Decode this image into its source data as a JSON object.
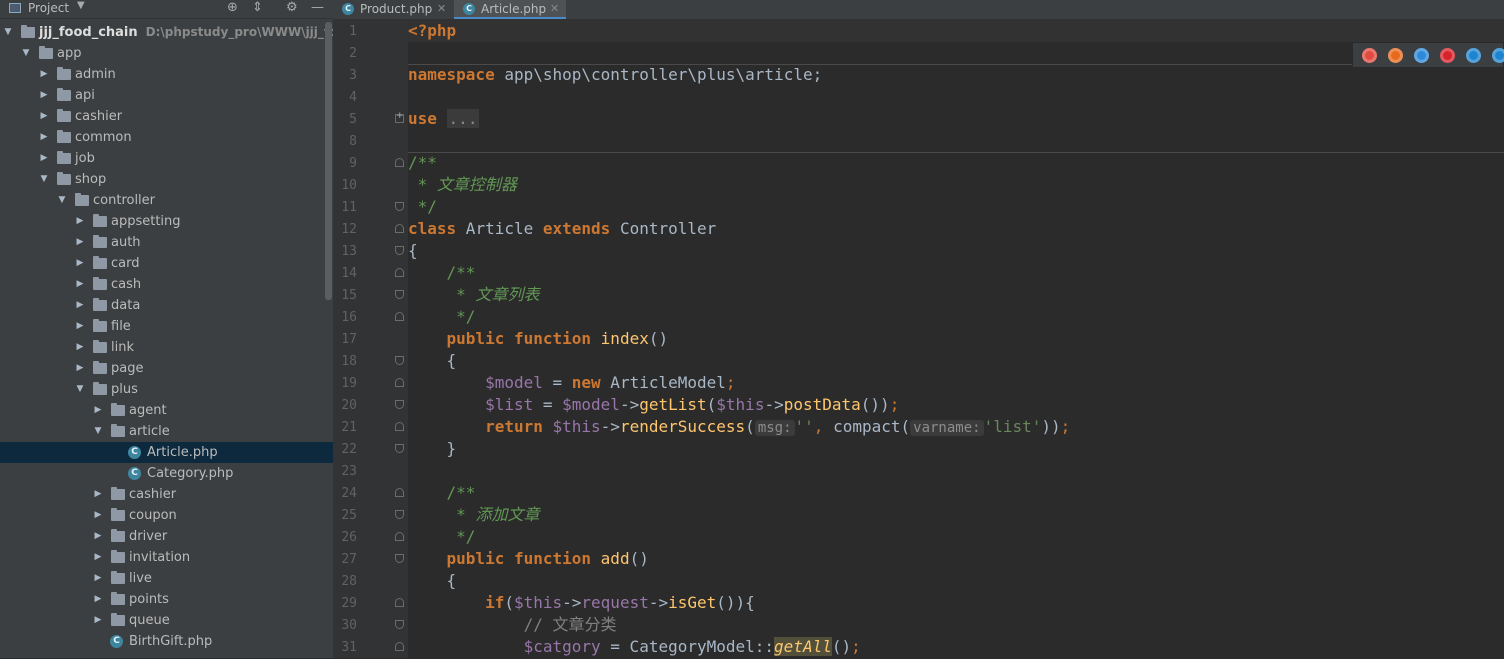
{
  "project_panel": {
    "title": "Project",
    "tree": [
      {
        "label": "jjj_food_chain",
        "hint": "D:\\phpstudy_pro\\WWW\\jjj_food_ch",
        "type": "root",
        "depth": 0,
        "open": true
      },
      {
        "label": "app",
        "type": "folder",
        "depth": 1,
        "open": true
      },
      {
        "label": "admin",
        "type": "folder",
        "depth": 2,
        "open": false
      },
      {
        "label": "api",
        "type": "folder",
        "depth": 2,
        "open": false
      },
      {
        "label": "cashier",
        "type": "folder",
        "depth": 2,
        "open": false
      },
      {
        "label": "common",
        "type": "folder",
        "depth": 2,
        "open": false
      },
      {
        "label": "job",
        "type": "folder",
        "depth": 2,
        "open": false
      },
      {
        "label": "shop",
        "type": "folder",
        "depth": 2,
        "open": true
      },
      {
        "label": "controller",
        "type": "folder",
        "depth": 3,
        "open": true
      },
      {
        "label": "appsetting",
        "type": "folder",
        "depth": 4,
        "open": false
      },
      {
        "label": "auth",
        "type": "folder",
        "depth": 4,
        "open": false
      },
      {
        "label": "card",
        "type": "folder",
        "depth": 4,
        "open": false
      },
      {
        "label": "cash",
        "type": "folder",
        "depth": 4,
        "open": false
      },
      {
        "label": "data",
        "type": "folder",
        "depth": 4,
        "open": false
      },
      {
        "label": "file",
        "type": "folder",
        "depth": 4,
        "open": false
      },
      {
        "label": "link",
        "type": "folder",
        "depth": 4,
        "open": false
      },
      {
        "label": "page",
        "type": "folder",
        "depth": 4,
        "open": false
      },
      {
        "label": "plus",
        "type": "folder",
        "depth": 4,
        "open": true
      },
      {
        "label": "agent",
        "type": "folder",
        "depth": 5,
        "open": false
      },
      {
        "label": "article",
        "type": "folder",
        "depth": 5,
        "open": true
      },
      {
        "label": "Article.php",
        "type": "file",
        "depth": 6,
        "selected": true
      },
      {
        "label": "Category.php",
        "type": "file",
        "depth": 6
      },
      {
        "label": "cashier",
        "type": "folder",
        "depth": 5,
        "open": false
      },
      {
        "label": "coupon",
        "type": "folder",
        "depth": 5,
        "open": false
      },
      {
        "label": "driver",
        "type": "folder",
        "depth": 5,
        "open": false
      },
      {
        "label": "invitation",
        "type": "folder",
        "depth": 5,
        "open": false
      },
      {
        "label": "live",
        "type": "folder",
        "depth": 5,
        "open": false
      },
      {
        "label": "points",
        "type": "folder",
        "depth": 5,
        "open": false
      },
      {
        "label": "queue",
        "type": "folder",
        "depth": 5,
        "open": false
      },
      {
        "label": "BirthGift.php",
        "type": "file",
        "depth": 5
      }
    ]
  },
  "tabs": [
    {
      "label": "Product.php",
      "active": false
    },
    {
      "label": "Article.php",
      "active": true
    }
  ],
  "editor": {
    "lines": [
      [
        {
          "c": "tag",
          "t": "<?php"
        }
      ],
      [],
      [
        {
          "c": "kw",
          "t": "namespace"
        },
        {
          "c": "",
          "t": " app\\shop\\controller\\plus\\article;"
        }
      ],
      [],
      [
        {
          "c": "kw",
          "t": "use"
        },
        {
          "c": "",
          "t": " "
        },
        {
          "c": "folded",
          "t": "..."
        }
      ],
      [],
      [],
      [],
      [
        {
          "c": "doc",
          "t": "/**"
        }
      ],
      [
        {
          "c": "doc",
          "t": " * "
        },
        {
          "c": "docz",
          "t": "文章控制器"
        }
      ],
      [
        {
          "c": "doc",
          "t": " */"
        }
      ],
      [
        {
          "c": "kw",
          "t": "class"
        },
        {
          "c": "",
          "t": " Article "
        },
        {
          "c": "kw",
          "t": "extends"
        },
        {
          "c": "",
          "t": " Controller"
        }
      ],
      [
        {
          "c": "",
          "t": "{"
        }
      ],
      [
        {
          "c": "",
          "t": "    "
        },
        {
          "c": "doc",
          "t": "/**"
        }
      ],
      [
        {
          "c": "doc",
          "t": "     * "
        },
        {
          "c": "docz",
          "t": "文章列表"
        }
      ],
      [
        {
          "c": "doc",
          "t": "     */"
        }
      ],
      [
        {
          "c": "",
          "t": "    "
        },
        {
          "c": "kw",
          "t": "public function"
        },
        {
          "c": "",
          "t": " "
        },
        {
          "c": "fn",
          "t": "index"
        },
        {
          "c": "",
          "t": "()"
        }
      ],
      [
        {
          "c": "",
          "t": "    {"
        }
      ],
      [
        {
          "c": "",
          "t": "        "
        },
        {
          "c": "var",
          "t": "$model"
        },
        {
          "c": "",
          "t": " = "
        },
        {
          "c": "kw",
          "t": "new"
        },
        {
          "c": "",
          "t": " ArticleModel"
        },
        {
          "c": "kwn",
          "t": ";"
        }
      ],
      [
        {
          "c": "",
          "t": "        "
        },
        {
          "c": "var",
          "t": "$list"
        },
        {
          "c": "",
          "t": " = "
        },
        {
          "c": "var",
          "t": "$model"
        },
        {
          "c": "",
          "t": "->"
        },
        {
          "c": "fn",
          "t": "getList"
        },
        {
          "c": "",
          "t": "("
        },
        {
          "c": "var",
          "t": "$this"
        },
        {
          "c": "",
          "t": "->"
        },
        {
          "c": "fn",
          "t": "postData"
        },
        {
          "c": "",
          "t": "())"
        },
        {
          "c": "kwn",
          "t": ";"
        }
      ],
      [
        {
          "c": "",
          "t": "        "
        },
        {
          "c": "kw",
          "t": "return"
        },
        {
          "c": "",
          "t": " "
        },
        {
          "c": "var",
          "t": "$this"
        },
        {
          "c": "",
          "t": "->"
        },
        {
          "c": "fn",
          "t": "renderSuccess"
        },
        {
          "c": "",
          "t": "("
        },
        {
          "c": "hint",
          "t": "msg:"
        },
        {
          "c": "str",
          "t": "''"
        },
        {
          "c": "kwn",
          "t": ","
        },
        {
          "c": "",
          "t": " compact("
        },
        {
          "c": "hint",
          "t": "varname:"
        },
        {
          "c": "str",
          "t": "'list'"
        },
        {
          "c": "",
          "t": "))"
        },
        {
          "c": "kwn",
          "t": ";"
        }
      ],
      [
        {
          "c": "",
          "t": "    }"
        }
      ],
      [],
      [
        {
          "c": "",
          "t": "    "
        },
        {
          "c": "doc",
          "t": "/**"
        }
      ],
      [
        {
          "c": "doc",
          "t": "     * "
        },
        {
          "c": "docz",
          "t": "添加文章"
        }
      ],
      [
        {
          "c": "doc",
          "t": "     */"
        }
      ],
      [
        {
          "c": "",
          "t": "    "
        },
        {
          "c": "kw",
          "t": "public function"
        },
        {
          "c": "",
          "t": " "
        },
        {
          "c": "fn",
          "t": "add"
        },
        {
          "c": "",
          "t": "()"
        }
      ],
      [
        {
          "c": "",
          "t": "    {"
        }
      ],
      [
        {
          "c": "",
          "t": "        "
        },
        {
          "c": "kw",
          "t": "if"
        },
        {
          "c": "",
          "t": "("
        },
        {
          "c": "var",
          "t": "$this"
        },
        {
          "c": "",
          "t": "->"
        },
        {
          "c": "var",
          "t": "request"
        },
        {
          "c": "",
          "t": "->"
        },
        {
          "c": "fn",
          "t": "isGet"
        },
        {
          "c": "",
          "t": "()){"
        }
      ],
      [
        {
          "c": "",
          "t": "            "
        },
        {
          "c": "cmt",
          "t": "// 文章分类"
        }
      ],
      [
        {
          "c": "",
          "t": "            "
        },
        {
          "c": "var",
          "t": "$catgory"
        },
        {
          "c": "",
          "t": " = CategoryModel::"
        },
        {
          "c": "hl",
          "t": "getAll"
        },
        {
          "c": "",
          "t": "()"
        },
        {
          "c": "kwn",
          "t": ";"
        }
      ]
    ],
    "line_numbers": [
      "1",
      "2",
      "3",
      "4",
      "5",
      "8",
      "9",
      "10",
      "11",
      "12",
      "13",
      "14",
      "15",
      "16",
      "17",
      "18",
      "19",
      "20",
      "21",
      "22",
      "23",
      "24",
      "25",
      "26",
      "27",
      "28",
      "29",
      "30",
      "31"
    ]
  },
  "browsers": [
    {
      "name": "chrome-icon",
      "color": "#e04a3f"
    },
    {
      "name": "firefox-icon",
      "color": "#e66a1e"
    },
    {
      "name": "safari-icon",
      "color": "#2d8ad8"
    },
    {
      "name": "opera-icon",
      "color": "#d8232a"
    },
    {
      "name": "ie-icon",
      "color": "#1e84d0"
    },
    {
      "name": "edge-icon",
      "color": "#1e84d0"
    }
  ]
}
